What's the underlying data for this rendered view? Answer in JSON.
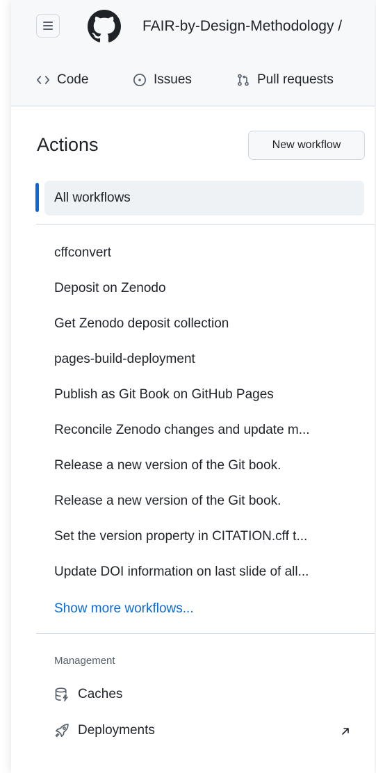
{
  "header": {
    "repo_title": "FAIR-by-Design-Methodology /",
    "tabs": [
      {
        "label": "Code",
        "icon": "code-icon"
      },
      {
        "label": "Issues",
        "icon": "issue-opened-icon"
      },
      {
        "label": "Pull requests",
        "icon": "git-pull-request-icon"
      }
    ]
  },
  "sidebar": {
    "title": "Actions",
    "new_workflow_label": "New workflow",
    "all_workflows_label": "All workflows",
    "workflows": [
      "cffconvert",
      "Deposit on Zenodo",
      "Get Zenodo deposit collection",
      "pages-build-deployment",
      "Publish as Git Book on GitHub Pages",
      "Reconcile Zenodo changes and update m...",
      "Release a new version of the Git book.",
      "Release a new version of the Git book.",
      "Set the version property in CITATION.cff t...",
      "Update DOI information on last slide of all..."
    ],
    "show_more_label": "Show more workflows...",
    "management": {
      "label": "Management",
      "items": [
        {
          "label": "Caches",
          "icon": "database-icon"
        },
        {
          "label": "Deployments",
          "icon": "rocket-icon",
          "external": true
        }
      ]
    }
  },
  "colors": {
    "accent": "#0969da",
    "text": "#1f2328",
    "muted": "#57606a",
    "border": "#d0d7de",
    "header_bg": "#f6f8fa",
    "selected_bg": "#eff2f5"
  }
}
